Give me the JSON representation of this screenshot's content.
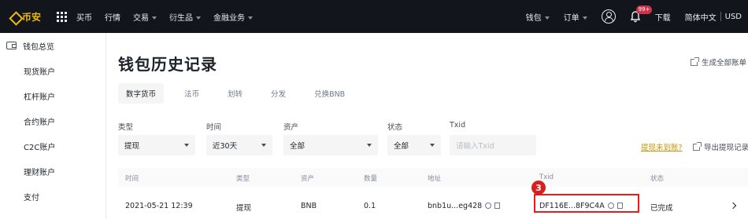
{
  "topnav": {
    "brand": "币安",
    "items": [
      "买币",
      "行情",
      "交易",
      "衍生品",
      "金融业务"
    ],
    "right": {
      "wallet": "钱包",
      "orders": "订单",
      "badge": "99+",
      "download": "下载",
      "lang": "简体中文",
      "currency": "USD"
    }
  },
  "sidebar": {
    "items": [
      "钱包总览",
      "现货账户",
      "杠杆账户",
      "合约账户",
      "C2C账户",
      "理财账户",
      "支付"
    ]
  },
  "page": {
    "title": "钱包历史记录",
    "gen_report": "生成全部账单"
  },
  "tabs": [
    "数字货币",
    "法币",
    "划转",
    "分发",
    "兑换BNB"
  ],
  "filters": {
    "type_label": "类型",
    "type_value": "提现",
    "time_label": "时间",
    "time_value": "近30天",
    "asset_label": "资产",
    "asset_value": "全部",
    "status_label": "状态",
    "status_value": "全部",
    "txid_label": "Txid",
    "txid_placeholder": "请输入Txid",
    "not_received": "提现未到账?",
    "export": "导出提现记录"
  },
  "table": {
    "headers": [
      "时间",
      "类型",
      "资产",
      "数量",
      "地址",
      "Txid",
      "状态"
    ],
    "row": {
      "time": "2021-05-21 12:39",
      "type": "提现",
      "asset": "BNB",
      "amount": "0.1",
      "address": "bnb1u...eg428",
      "txid": "DF116E...8F9C4A",
      "status": "已完成"
    }
  },
  "annotation": {
    "step": "3",
    "color": "#e02020"
  },
  "colors": {
    "brand": "#f0b90b",
    "nav_bg": "#12161c"
  }
}
